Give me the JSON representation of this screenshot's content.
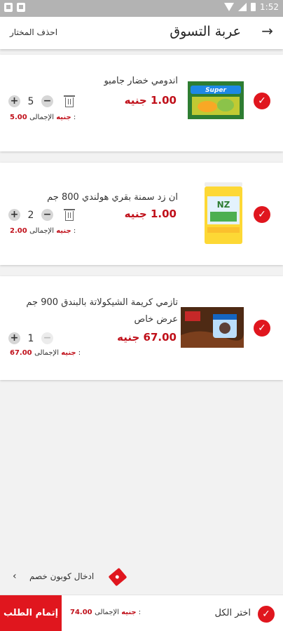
{
  "status_bar": {
    "time": "1:52"
  },
  "header": {
    "title": "عربة التسوق",
    "back_icon": "arrow-right-icon",
    "delete_selected": "احذف المختار"
  },
  "items": [
    {
      "name": "اندومي خضار جامبو",
      "name_line2": "",
      "price": "1.00 جنيه",
      "qty": "5",
      "total_label": "الإجمالى :",
      "total_value": "5.00 جنيه"
    },
    {
      "name": "ان زد سمنة بقري هولندي 800 جم",
      "name_line2": "",
      "price": "1.00 جنيه",
      "qty": "2",
      "total_label": "الإجمالى :",
      "total_value": "2.00 جنيه"
    },
    {
      "name": "تازمي كريمة الشيكولاتة بالبندق 900 جم",
      "name_line2": "عرض خاص",
      "price": "67.00 جنيه",
      "qty": "1",
      "total_label": "الإجمالى :",
      "total_value": "67.00 جنيه"
    }
  ],
  "coupon": {
    "label": "ادخال كوبون خصم"
  },
  "footer": {
    "checkout": "إتمام الطلب",
    "total_label": "الإجمالى :",
    "total_value": "74.00 جنيه",
    "select_all": "اختر الكل"
  },
  "colors": {
    "accent": "#e0161e",
    "price": "#c0101a"
  }
}
